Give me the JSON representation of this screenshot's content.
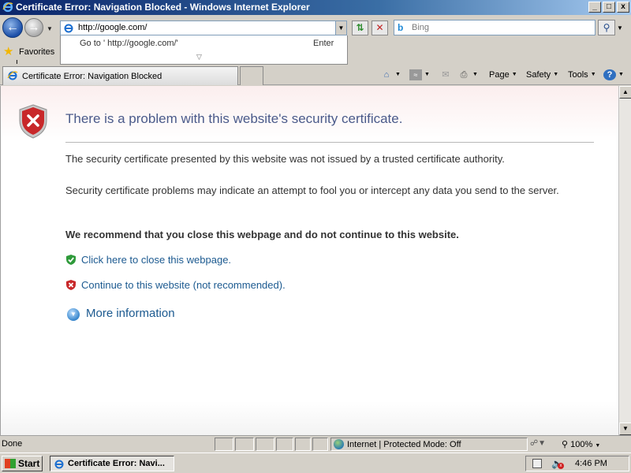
{
  "window": {
    "title": "Certificate Error: Navigation Blocked - Windows Internet Explorer",
    "minimize_glyph": "_",
    "maximize_glyph": "□",
    "close_glyph": "x"
  },
  "nav": {
    "address_value": "http://google.com/",
    "autocomplete_goto": "Go to ' http://google.com/'",
    "autocomplete_enter": "Enter",
    "search_placeholder": "Bing"
  },
  "favorites": {
    "label": "Favorites"
  },
  "tab": {
    "label": "Certificate Error: Navigation Blocked"
  },
  "command_bar": {
    "page": "Page",
    "safety": "Safety",
    "tools": "Tools"
  },
  "content": {
    "title": "There is a problem with this website's security certificate.",
    "paragraph1": "The security certificate presented by this website was not issued by a trusted certificate authority.",
    "paragraph2": "Security certificate problems may indicate an attempt to fool you or intercept any data you send to the server.",
    "recommendation": "We recommend that you close this webpage and do not continue to this website.",
    "close_link": "Click here to close this webpage.",
    "continue_link": "Continue to this website (not recommended).",
    "more_info": "More information"
  },
  "status": {
    "text": "Done",
    "zone": "Internet | Protected Mode: Off",
    "zoom": "100%"
  },
  "taskbar": {
    "start": "Start",
    "task": "Certificate Error: Navi...",
    "clock": "4:46 PM"
  },
  "colors": {
    "title_blue": "#4a5a8a",
    "link_blue": "#1c5a90",
    "titlebar": "#0a246a"
  },
  "icons": [
    "ie-icon",
    "back-icon",
    "forward-icon",
    "refresh-icon",
    "stop-icon",
    "bing-icon",
    "search-icon",
    "star-icon",
    "home-icon",
    "feed-icon",
    "mail-icon",
    "print-icon",
    "help-icon",
    "shield-error-icon",
    "shield-check-icon",
    "shield-x-icon",
    "expand-icon",
    "globe-icon",
    "zoom-icon",
    "network-icon",
    "volume-icon"
  ]
}
